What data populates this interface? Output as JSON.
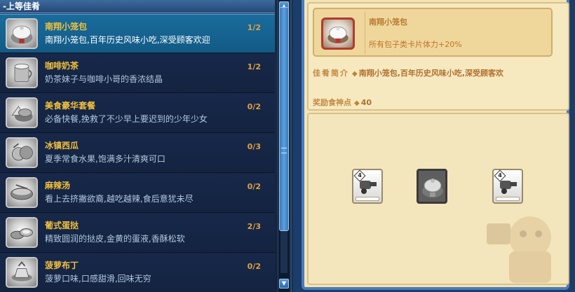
{
  "category": {
    "label": "-上等佳肴"
  },
  "dishes": [
    {
      "name": "南翔小笼包",
      "desc": "南翔小笼包,百年历史风味小吃,深受顾客欢迎",
      "count": "1/2",
      "icon": "steamed-bun-icon",
      "selected": true
    },
    {
      "name": "咖啡奶茶",
      "desc": "奶茶妹子与咖啡小哥的香浓结晶",
      "count": "1/2",
      "icon": "milk-tea-icon"
    },
    {
      "name": "美食豪华套餐",
      "desc": "必备快餐,挽救了不少早上要迟到的少年少女",
      "count": "0/2",
      "icon": "combo-meal-icon"
    },
    {
      "name": "冰镇西瓜",
      "desc": "夏季常食水果,饱满多汁清爽可口",
      "count": "0/3",
      "icon": "watermelon-icon"
    },
    {
      "name": "麻辣汤",
      "desc": "看上去挤撇欲裔,越吃越辣,食后意犹未尽",
      "count": "0/2",
      "icon": "spicy-soup-icon"
    },
    {
      "name": "葡式蛋挞",
      "desc": "精致圆润的挞皮,金黄的蛋液,香酥松软",
      "count": "2/3",
      "icon": "egg-tart-icon"
    },
    {
      "name": "菠萝布丁",
      "desc": "菠萝口味,口感甜滑,回味无穷",
      "count": "0/2",
      "icon": "pudding-icon"
    }
  ],
  "detail": {
    "name": "南翔小笼包",
    "bonus": "所有包子类卡片体力+20%",
    "intro_label": "佳肴简介",
    "intro_text": "南翔小笼包,百年历史风味小吃,深受顾客欢",
    "reward_label": "奖励食神点",
    "reward_value": "40"
  },
  "slots": [
    {
      "type": "card",
      "badge": "4",
      "icon": "cannon-card-icon"
    },
    {
      "type": "dish",
      "icon": "steamed-bun-icon"
    },
    {
      "type": "card",
      "badge": "4",
      "icon": "cannon-card-icon"
    }
  ],
  "colors": {
    "dish_name": "#f2c13c",
    "selected_row": "#1a6c9c",
    "detail_bg": "#f3e4b6",
    "accent_brown": "#c28a44"
  }
}
